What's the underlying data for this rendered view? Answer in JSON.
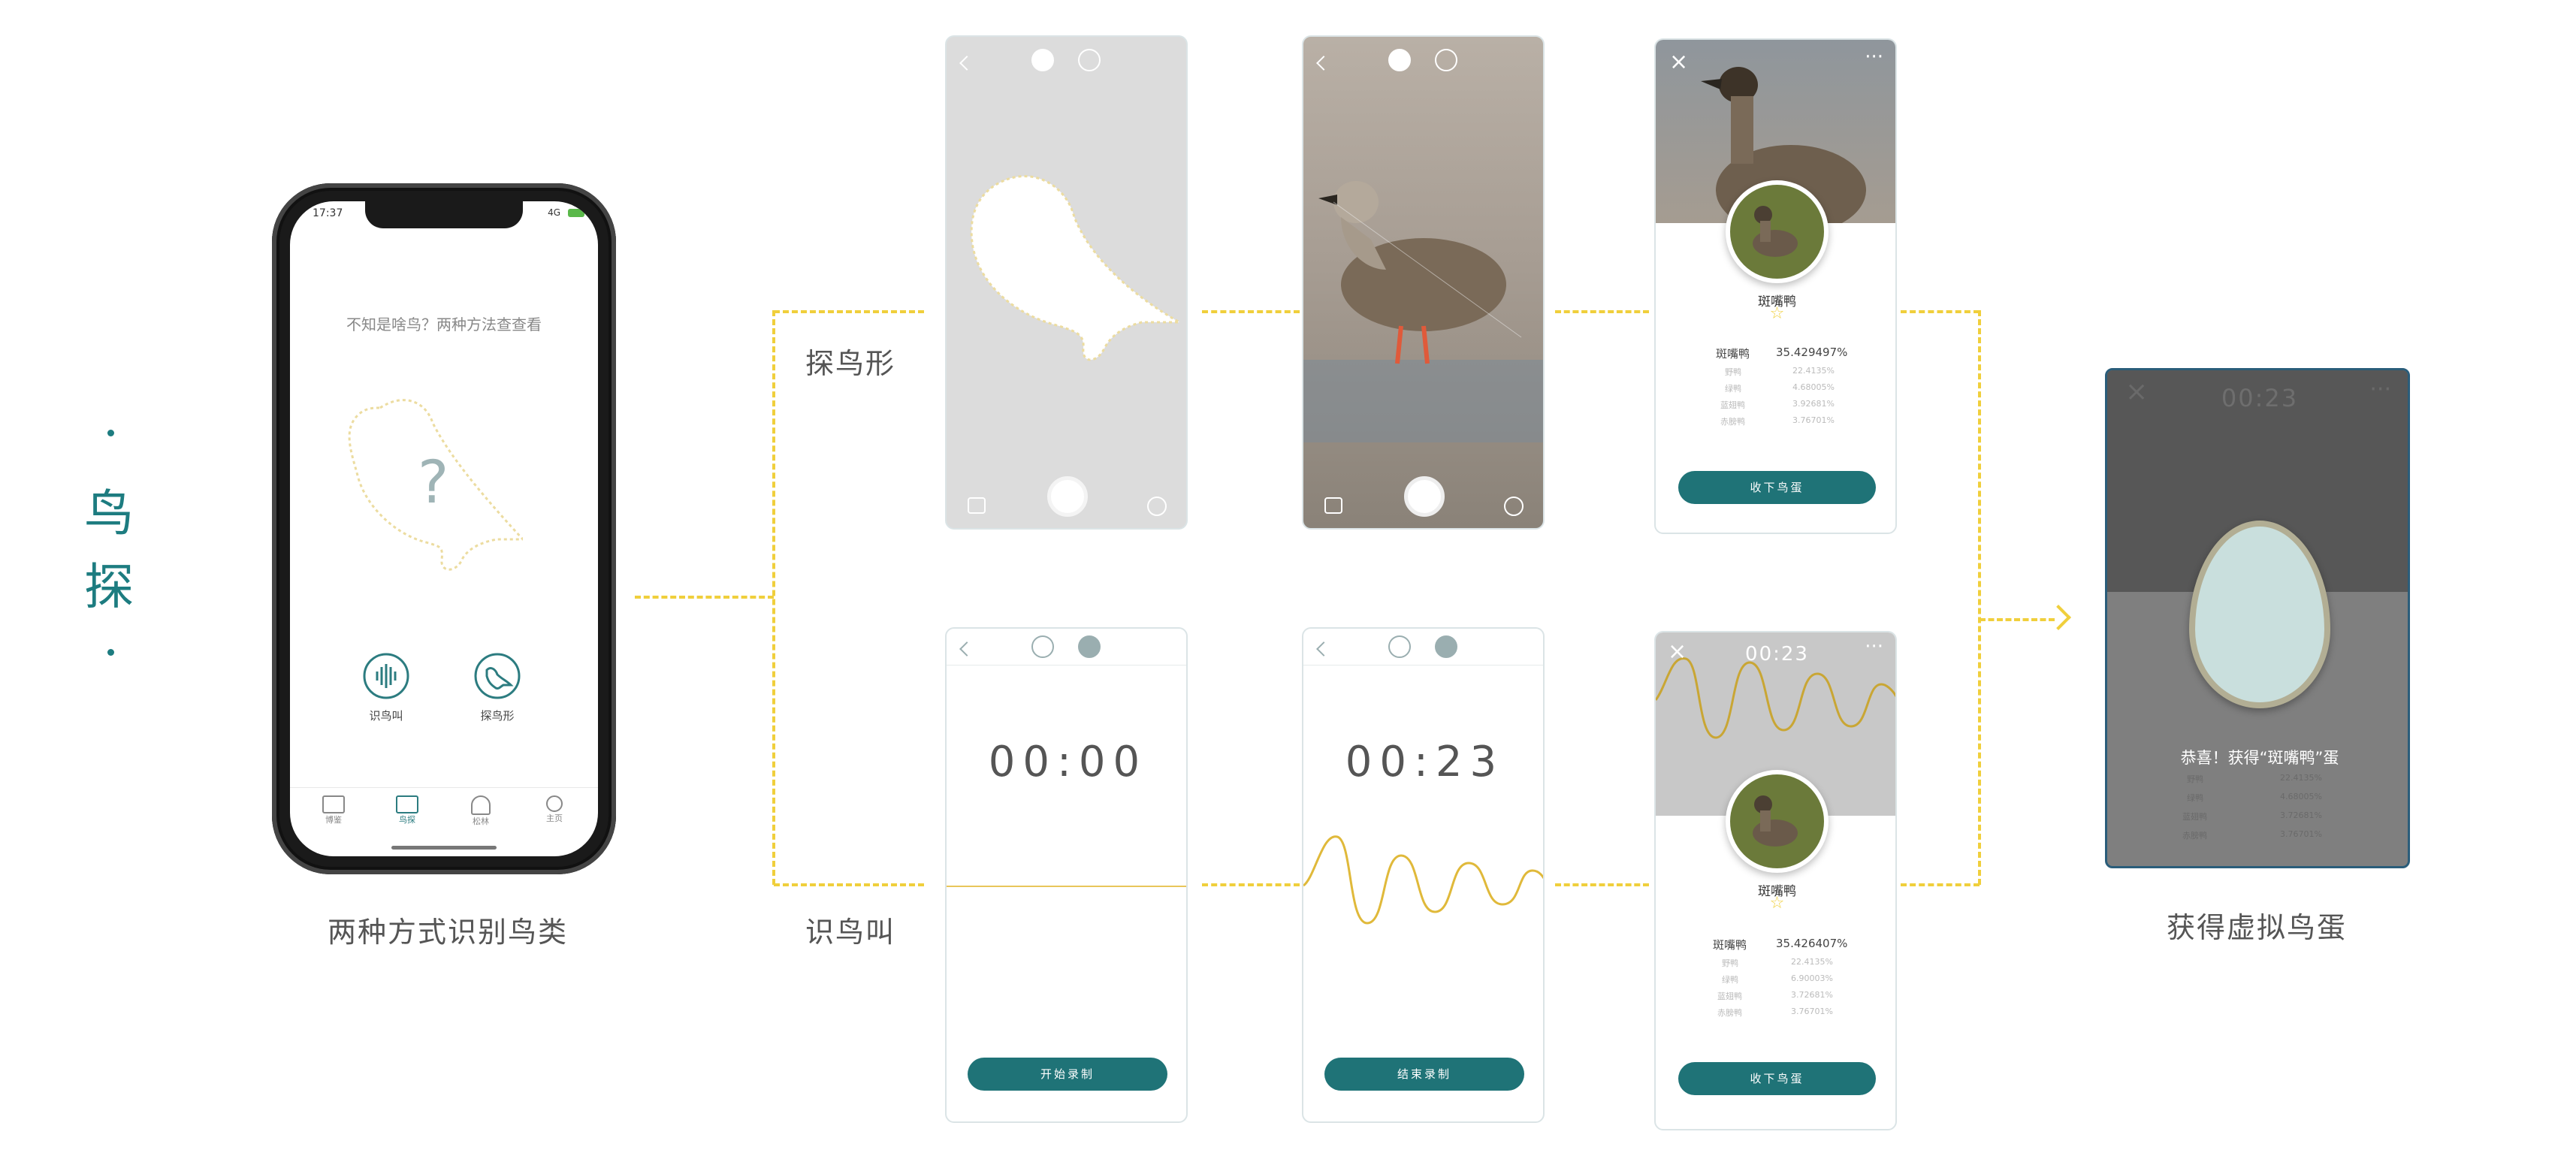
{
  "title": {
    "char1": "鸟",
    "char2": "探"
  },
  "phone_main": {
    "time": "17:37",
    "signal": "4G",
    "prompt": "不知是啥鸟？两种方法查查看",
    "question": "?",
    "actions": [
      {
        "label": "识鸟叫",
        "icon": "sound-wave-icon"
      },
      {
        "label": "探鸟形",
        "icon": "bird-icon"
      }
    ],
    "tabs": [
      {
        "label": "博鉴",
        "icon": "book-icon"
      },
      {
        "label": "鸟探",
        "icon": "bird-scan-icon"
      },
      {
        "label": "松林",
        "icon": "tree-icon"
      },
      {
        "label": "主页",
        "icon": "person-icon"
      }
    ]
  },
  "captions": {
    "main": "两种方式识别鸟类",
    "shape": "探鸟形",
    "sound": "识鸟叫",
    "result": "获得虚拟鸟蛋"
  },
  "shape_camera": {
    "hint": ""
  },
  "shape_photo": {
    "hint": ""
  },
  "shape_result": {
    "species": "斑嘴鸭",
    "top_name": "斑嘴鸭",
    "top_pct": "35.429497%",
    "others": [
      {
        "name": "野鸭",
        "pct": "22.4135%"
      },
      {
        "name": "绿鸭",
        "pct": "4.68005%"
      },
      {
        "name": "蓝翅鸭",
        "pct": "3.92681%"
      },
      {
        "name": "赤膀鸭",
        "pct": "3.76701%"
      }
    ],
    "button": "收下鸟蛋"
  },
  "sound_idle": {
    "timer": "00:00",
    "button": "开始录制"
  },
  "sound_record": {
    "timer": "00:23",
    "button": "结束录制"
  },
  "sound_result": {
    "timer": "00:23",
    "species": "斑嘴鸭",
    "top_name": "斑嘴鸭",
    "top_pct": "35.426407%",
    "others": [
      {
        "name": "野鸭",
        "pct": "22.4135%"
      },
      {
        "name": "绿鸭",
        "pct": "6.90003%"
      },
      {
        "name": "蓝翅鸭",
        "pct": "3.72681%"
      },
      {
        "name": "赤膀鸭",
        "pct": "3.76701%"
      }
    ],
    "button": "收下鸟蛋"
  },
  "egg": {
    "timer": "00:23",
    "congrats": "恭喜！获得“斑嘴鸭”蛋",
    "others": [
      {
        "name": "野鸭",
        "pct": "22.4135%"
      },
      {
        "name": "绿鸭",
        "pct": "4.68005%"
      },
      {
        "name": "蓝翅鸭",
        "pct": "3.72681%"
      },
      {
        "name": "赤膀鸭",
        "pct": "3.76701%"
      }
    ]
  },
  "colors": {
    "teal": "#1f7377",
    "accent": "#f0cf3c",
    "title": "#1d7c80"
  }
}
